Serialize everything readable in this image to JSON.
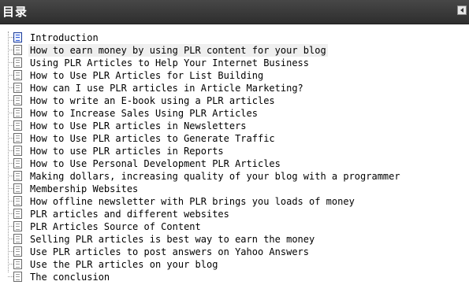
{
  "panel": {
    "title": "目录"
  },
  "items": [
    {
      "label": "Introduction",
      "icon": "document-blue-icon"
    },
    {
      "label": "How to earn money by using PLR content for your blog",
      "icon": "document-icon",
      "selected": true
    },
    {
      "label": "Using PLR Articles to Help Your Internet Business",
      "icon": "document-icon"
    },
    {
      "label": "How to Use PLR Articles for List Building",
      "icon": "document-icon"
    },
    {
      "label": "How can I use PLR articles in Article Marketing?",
      "icon": "document-icon"
    },
    {
      "label": "How to write an E-book using a PLR articles",
      "icon": "document-icon"
    },
    {
      "label": "How to Increase Sales Using PLR Articles",
      "icon": "document-icon"
    },
    {
      "label": "How to Use PLR articles in Newsletters",
      "icon": "document-icon"
    },
    {
      "label": "How to Use PLR articles to Generate Traffic",
      "icon": "document-icon"
    },
    {
      "label": "How to use PLR articles in Reports",
      "icon": "document-icon"
    },
    {
      "label": "How to Use Personal Development PLR Articles",
      "icon": "document-icon"
    },
    {
      "label": "Making dollars, increasing quality of your blog with a programmer",
      "icon": "document-icon"
    },
    {
      "label": "Membership Websites",
      "icon": "document-icon"
    },
    {
      "label": "How offline newsletter with PLR brings you loads of money",
      "icon": "document-icon"
    },
    {
      "label": "PLR articles and different websites",
      "icon": "document-icon"
    },
    {
      "label": "PLR Articles Source of Content",
      "icon": "document-icon"
    },
    {
      "label": "Selling PLR articles is best way to earn the money",
      "icon": "document-icon"
    },
    {
      "label": "Use PLR articles to post answers on Yahoo Answers",
      "icon": "document-icon"
    },
    {
      "label": "Use the PLR articles on your blog",
      "icon": "document-icon"
    },
    {
      "label": "The conclusion",
      "icon": "document-icon"
    }
  ]
}
